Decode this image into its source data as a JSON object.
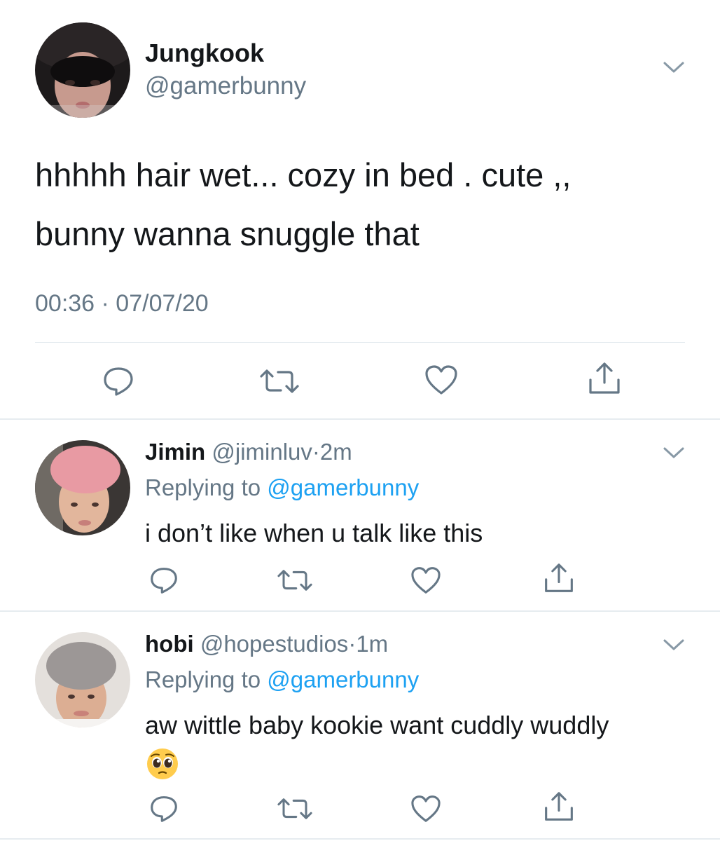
{
  "main_tweet": {
    "author_name": "Jungkook",
    "author_handle": "@gamerbunny",
    "text_line1": "hhhhh hair wet... cozy in bed . cute ,,",
    "text_line2": "bunny wanna snuggle that",
    "timestamp": "00:36 · 07/07/20",
    "avatar_icon": "profile-photo"
  },
  "replies": [
    {
      "author_name": "Jimin",
      "author_handle": "@jiminluv",
      "separator": "·",
      "time": "2m",
      "replying_prefix": "Replying to ",
      "replying_mention": "@gamerbunny",
      "text": "i don’t like when u talk like this"
    },
    {
      "author_name": "hobi",
      "author_handle": "@hopestudios",
      "separator": "·",
      "time": "1m",
      "replying_prefix": "Replying to ",
      "replying_mention": "@gamerbunny",
      "text": "aw wittle baby kookie want cuddly wuddly",
      "emoji": "pleading-face"
    }
  ],
  "colors": {
    "text": "#14171a",
    "secondary": "#657786",
    "mention": "#1da1f2",
    "divider": "#e6ecf0"
  },
  "icons": [
    "chevron-down-icon",
    "reply-icon",
    "retweet-icon",
    "like-icon",
    "share-icon"
  ]
}
